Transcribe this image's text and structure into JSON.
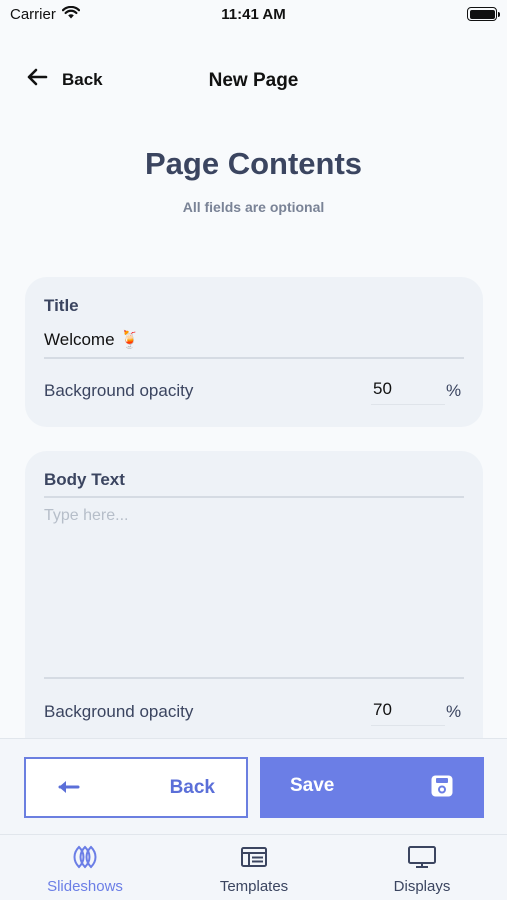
{
  "status_bar": {
    "carrier": "Carrier",
    "time": "11:41 AM"
  },
  "nav": {
    "back_label": "Back",
    "title": "New Page"
  },
  "heading": {
    "title": "Page Contents",
    "subtitle": "All fields are optional"
  },
  "title_card": {
    "label": "Title",
    "value": "Welcome 🍹",
    "opacity_label": "Background opacity",
    "opacity_value": "50",
    "opacity_unit": "%"
  },
  "body_card": {
    "label": "Body Text",
    "placeholder": "Type here...",
    "opacity_label": "Background opacity",
    "opacity_value": "70",
    "opacity_unit": "%"
  },
  "actions": {
    "back_label": "Back",
    "save_label": "Save"
  },
  "tabs": [
    {
      "label": "Slideshows",
      "icon": "slideshows-icon",
      "active": true
    },
    {
      "label": "Templates",
      "icon": "templates-icon",
      "active": false
    },
    {
      "label": "Displays",
      "icon": "displays-icon",
      "active": false
    }
  ],
  "colors": {
    "accent": "#6b7ee6",
    "heading": "#3b4560",
    "card_bg": "#eef2f7"
  }
}
